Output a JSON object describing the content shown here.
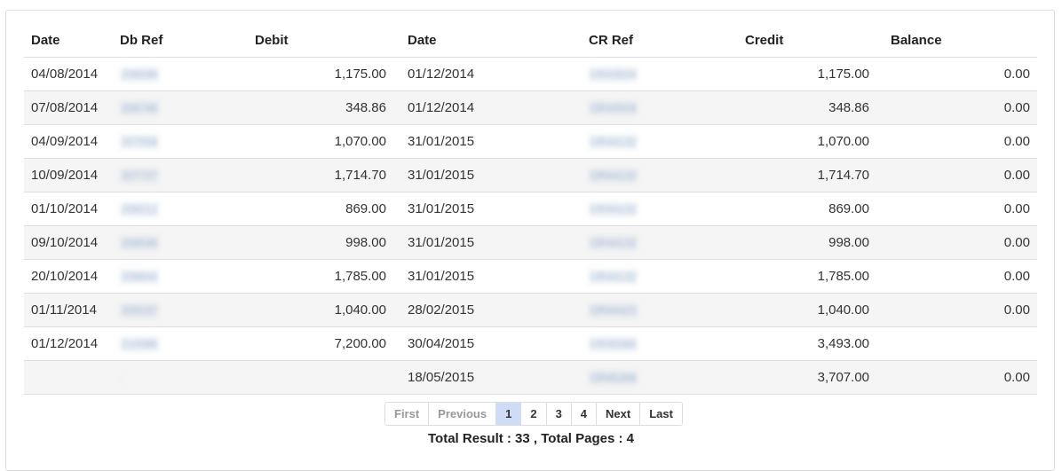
{
  "table": {
    "headers": [
      "Date",
      "Db Ref",
      "Debit",
      "Date",
      "CR Ref",
      "Credit",
      "Balance"
    ],
    "rows": [
      {
        "db_date": "04/08/2014",
        "db_ref": "206599",
        "debit": "1,175.00",
        "cr_date": "01/12/2014",
        "cr_ref": "OR43504",
        "credit": "1,175.00",
        "balance": "0.00"
      },
      {
        "db_date": "07/08/2014",
        "db_ref": "206748",
        "debit": "348.86",
        "cr_date": "01/12/2014",
        "cr_ref": "OR43504",
        "credit": "348.86",
        "balance": "0.00"
      },
      {
        "db_date": "04/09/2014",
        "db_ref": "207558",
        "debit": "1,070.00",
        "cr_date": "31/01/2015",
        "cr_ref": "OR44132",
        "credit": "1,070.00",
        "balance": "0.00"
      },
      {
        "db_date": "10/09/2014",
        "db_ref": "207727",
        "debit": "1,714.70",
        "cr_date": "31/01/2015",
        "cr_ref": "OR44132",
        "credit": "1,714.70",
        "balance": "0.00"
      },
      {
        "db_date": "01/10/2014",
        "db_ref": "208212",
        "debit": "869.00",
        "cr_date": "31/01/2015",
        "cr_ref": "OR44132",
        "credit": "869.00",
        "balance": "0.00"
      },
      {
        "db_date": "09/10/2014",
        "db_ref": "208548",
        "debit": "998.00",
        "cr_date": "31/01/2015",
        "cr_ref": "OR44132",
        "credit": "998.00",
        "balance": "0.00"
      },
      {
        "db_date": "20/10/2014",
        "db_ref": "208844",
        "debit": "1,785.00",
        "cr_date": "31/01/2015",
        "cr_ref": "OR44132",
        "credit": "1,785.00",
        "balance": "0.00"
      },
      {
        "db_date": "01/11/2014",
        "db_ref": "209187",
        "debit": "1,040.00",
        "cr_date": "28/02/2015",
        "cr_ref": "OR44423",
        "credit": "1,040.00",
        "balance": "0.00"
      },
      {
        "db_date": "01/12/2014",
        "db_ref": "210086",
        "debit": "7,200.00",
        "cr_date": "30/04/2015",
        "cr_ref": "OR45066",
        "credit": "3,493.00",
        "balance": ""
      },
      {
        "db_date": "",
        "db_ref": "",
        "debit": "",
        "cr_date": "18/05/2015",
        "cr_ref": "OR45268",
        "credit": "3,707.00",
        "balance": "0.00"
      }
    ]
  },
  "pagination": {
    "first": "First",
    "previous": "Previous",
    "pages": [
      "1",
      "2",
      "3",
      "4"
    ],
    "active_page": "1",
    "next": "Next",
    "last": "Last"
  },
  "summary": "Total Result : 33 , Total Pages : 4"
}
